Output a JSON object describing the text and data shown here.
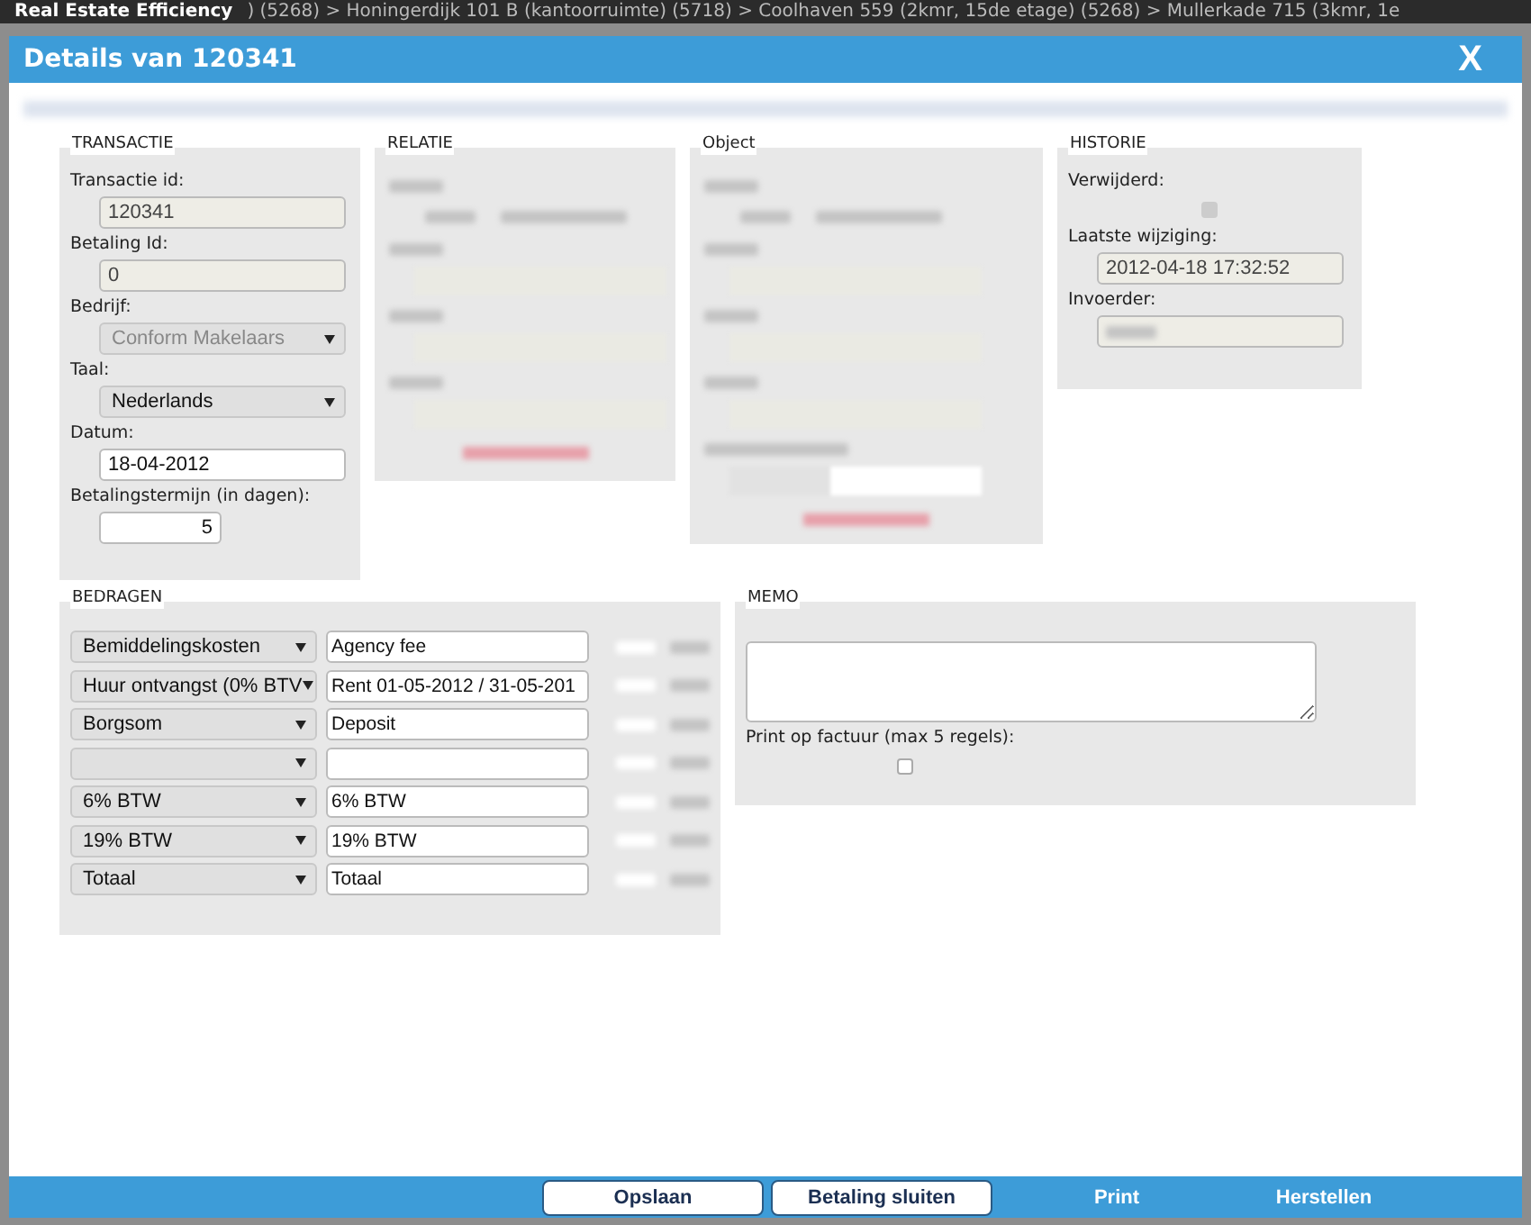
{
  "app": {
    "title": "Real Estate Efficiency",
    "breadcrumb": ") (5268) > Honingerdijk 101 B (kantoorruimte) (5718) > Coolhaven 559 (2kmr, 15de etage) (5268) > Mullerkade 715 (3kmr, 1e"
  },
  "dialog": {
    "title": "Details van 120341",
    "close": "X"
  },
  "transactie": {
    "title": "TRANSACTIE",
    "fields": [
      {
        "label": "Transactie id:",
        "kind": "text",
        "value": "120341",
        "disabled": true
      },
      {
        "label": "Betaling Id:",
        "kind": "text",
        "value": "0",
        "disabled": true
      },
      {
        "label": "Bedrijf:",
        "kind": "select",
        "value": "Conform Makelaars",
        "disabled": true
      },
      {
        "label": "Taal:",
        "kind": "select",
        "value": "Nederlands",
        "disabled": false
      },
      {
        "label": "Datum:",
        "kind": "text",
        "value": "18-04-2012",
        "disabled": false
      },
      {
        "label": "Betalingstermijn (in dagen):",
        "kind": "number",
        "value": "5",
        "disabled": false
      }
    ]
  },
  "relatie": {
    "title": "RELATIE",
    "rows": [
      {
        "kind": "pair"
      },
      {
        "kind": "field"
      },
      {
        "kind": "field"
      },
      {
        "kind": "field"
      },
      {
        "kind": "link"
      }
    ]
  },
  "object": {
    "title": "Object",
    "rows": [
      {
        "kind": "pair"
      },
      {
        "kind": "field"
      },
      {
        "kind": "field"
      },
      {
        "kind": "field"
      },
      {
        "kind": "date"
      },
      {
        "kind": "link"
      }
    ]
  },
  "historie": {
    "title": "HISTORIE",
    "fields": [
      {
        "label": "Verwijderd:",
        "kind": "checkbox",
        "checked": false,
        "disabled": true
      },
      {
        "label": "Laatste wijziging:",
        "kind": "text",
        "value": "2012-04-18 17:32:52",
        "disabled": true
      },
      {
        "label": "Invoerder:",
        "kind": "blurred",
        "disabled": true
      }
    ]
  },
  "bedragen": {
    "title": "BEDRAGEN",
    "rows": [
      {
        "category": "Bemiddelingskosten",
        "description": "Agency fee"
      },
      {
        "category": "Huur ontvangst (0% BTV",
        "description": "Rent 01-05-2012 / 31-05-201"
      },
      {
        "category": "Borgsom",
        "description": "Deposit"
      },
      {},
      {
        "category": "6% BTW",
        "description": "6% BTW"
      },
      {
        "category": "19% BTW",
        "description": "19% BTW"
      },
      {
        "category": "Totaal",
        "description": "Totaal"
      }
    ]
  },
  "memo": {
    "title": "MEMO",
    "print_label": "Print op factuur (max 5 regels):",
    "print_checked": false
  },
  "footer": {
    "buttons": [
      {
        "label": "Opslaan",
        "kind": "button"
      },
      {
        "label": "Betaling sluiten",
        "kind": "button"
      },
      {
        "label": "Print",
        "kind": "link"
      },
      {
        "label": "Herstellen",
        "kind": "link"
      }
    ]
  }
}
